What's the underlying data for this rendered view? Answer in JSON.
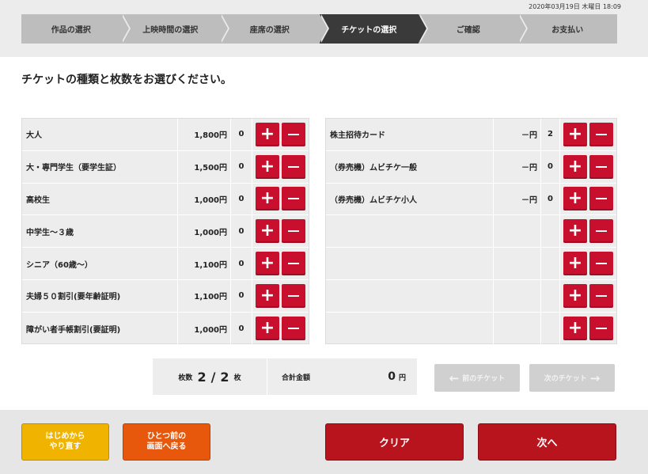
{
  "header": {
    "datetime": "2020年03月19日 木曜日 18:09",
    "steps": [
      {
        "label": "作品の選択",
        "active": false
      },
      {
        "label": "上映時間の選択",
        "active": false
      },
      {
        "label": "座席の選択",
        "active": false
      },
      {
        "label": "チケットの選択",
        "active": true
      },
      {
        "label": "ご確認",
        "active": false
      },
      {
        "label": "お支払い",
        "active": false
      }
    ]
  },
  "heading": "チケットの種類と枚数をお選びください。",
  "left_tickets": [
    {
      "name": "大人",
      "price": "1,800円",
      "count": "0"
    },
    {
      "name": "大・専門学生（要学生証）",
      "price": "1,500円",
      "count": "0"
    },
    {
      "name": "高校生",
      "price": "1,000円",
      "count": "0"
    },
    {
      "name": "中学生～３歳",
      "price": "1,000円",
      "count": "0"
    },
    {
      "name": "シニア（60歳～）",
      "price": "1,100円",
      "count": "0"
    },
    {
      "name": "夫婦５０割引(要年齢証明)",
      "price": "1,100円",
      "count": "0"
    },
    {
      "name": "障がい者手帳割引(要証明)",
      "price": "1,000円",
      "count": "0"
    }
  ],
  "right_tickets": [
    {
      "name": "株主招待カード",
      "price": "－円",
      "count": "2"
    },
    {
      "name": "（券売機）ムビチケ一般",
      "price": "－円",
      "count": "0"
    },
    {
      "name": "（券売機）ムビチケ小人",
      "price": "－円",
      "count": "0"
    },
    {
      "name": "",
      "price": "",
      "count": ""
    },
    {
      "name": "",
      "price": "",
      "count": ""
    },
    {
      "name": "",
      "price": "",
      "count": ""
    },
    {
      "name": "",
      "price": "",
      "count": ""
    }
  ],
  "buttons": {
    "plus": "+"
  },
  "summary": {
    "count_label": "枚数",
    "selected": "2",
    "separator": "/",
    "total_seats": "2",
    "count_unit": "枚",
    "amount_label": "合計金額",
    "amount": "0",
    "amount_unit": "円"
  },
  "nav": {
    "prev_label": "前のチケット",
    "next_label": "次のチケット",
    "prev_arrow": "←",
    "next_arrow": "→"
  },
  "footer": {
    "restart_line1": "はじめから",
    "restart_line2": "やり直す",
    "back_line1": "ひとつ前の",
    "back_line2": "画面へ戻る",
    "clear_label": "クリア",
    "next_label": "次へ"
  },
  "colors": {
    "accent_red": "#c8102e",
    "restart_yellow": "#f0b400",
    "back_orange": "#e8580c",
    "active_step": "#3a3a3a"
  }
}
